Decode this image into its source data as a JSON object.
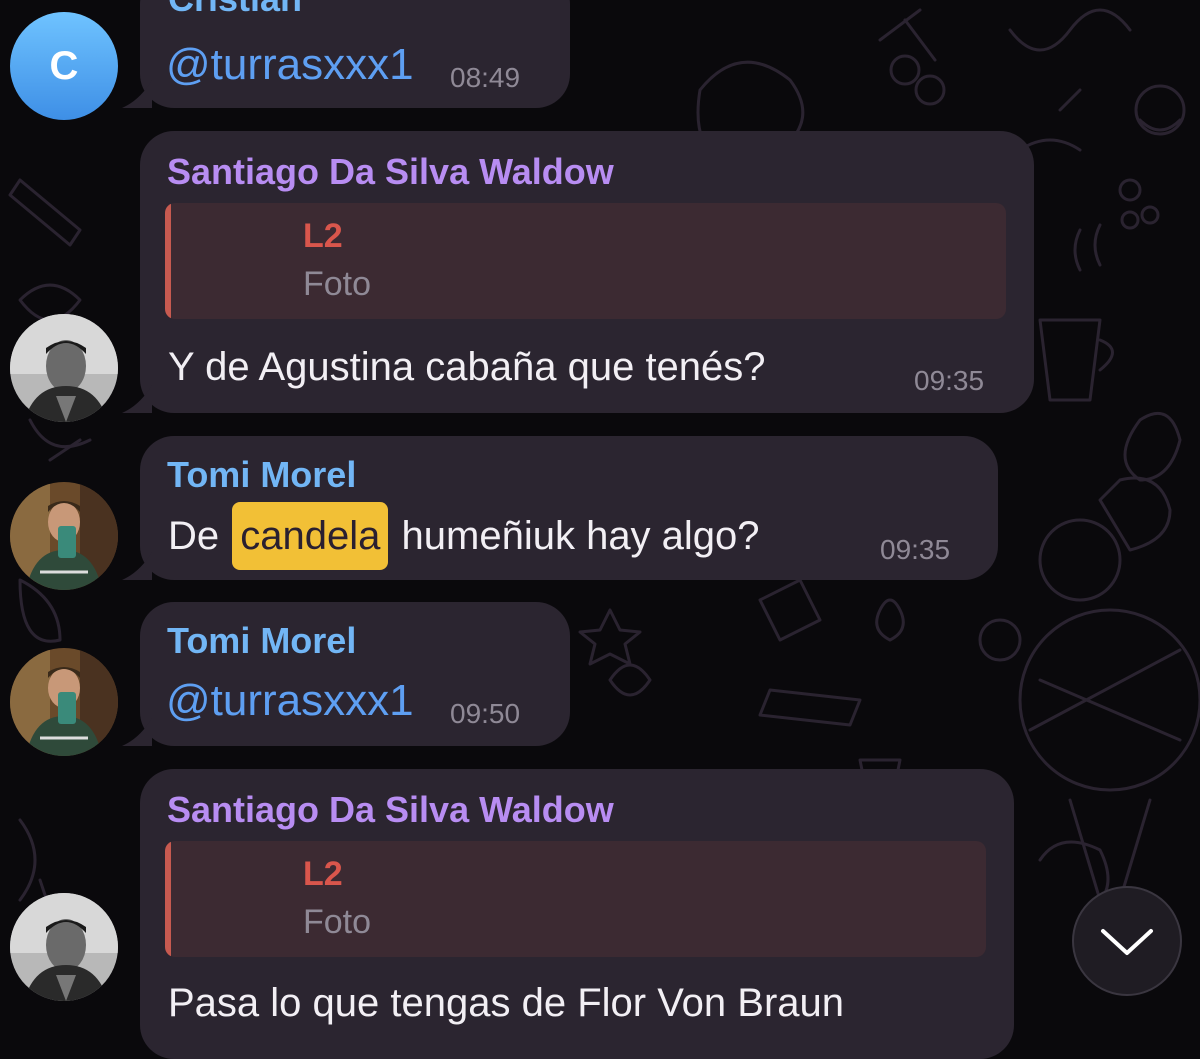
{
  "messages": [
    {
      "sender": "Cristian",
      "avatar_letter": "C",
      "text": "@turrasxxx1",
      "time": "08:49"
    },
    {
      "sender": "Santiago Da Silva Waldow",
      "reply": {
        "title": "L2",
        "text": "Foto"
      },
      "text": "Y de Agustina cabaña que tenés?",
      "time": "09:35"
    },
    {
      "sender": "Tomi Morel",
      "text_before": "De",
      "highlight": "candela",
      "text_after": "humeñiuk hay algo?",
      "time": "09:35"
    },
    {
      "sender": "Tomi Morel",
      "text": "@turrasxxx1",
      "time": "09:50"
    },
    {
      "sender": "Santiago Da Silva Waldow",
      "reply": {
        "title": "L2",
        "text": "Foto"
      },
      "text": "Pasa lo que tengas de Flor Von Braun"
    }
  ],
  "colors": {
    "background": "#0a090c",
    "bubble": "#2b2530",
    "sender_purple": "#b88df2",
    "sender_blue": "#72b6f5",
    "mention": "#5e9ff2",
    "highlight": "#f2c036",
    "reply_accent": "#d9564c"
  },
  "icons": {
    "scroll_down": "chevron-down-icon"
  }
}
